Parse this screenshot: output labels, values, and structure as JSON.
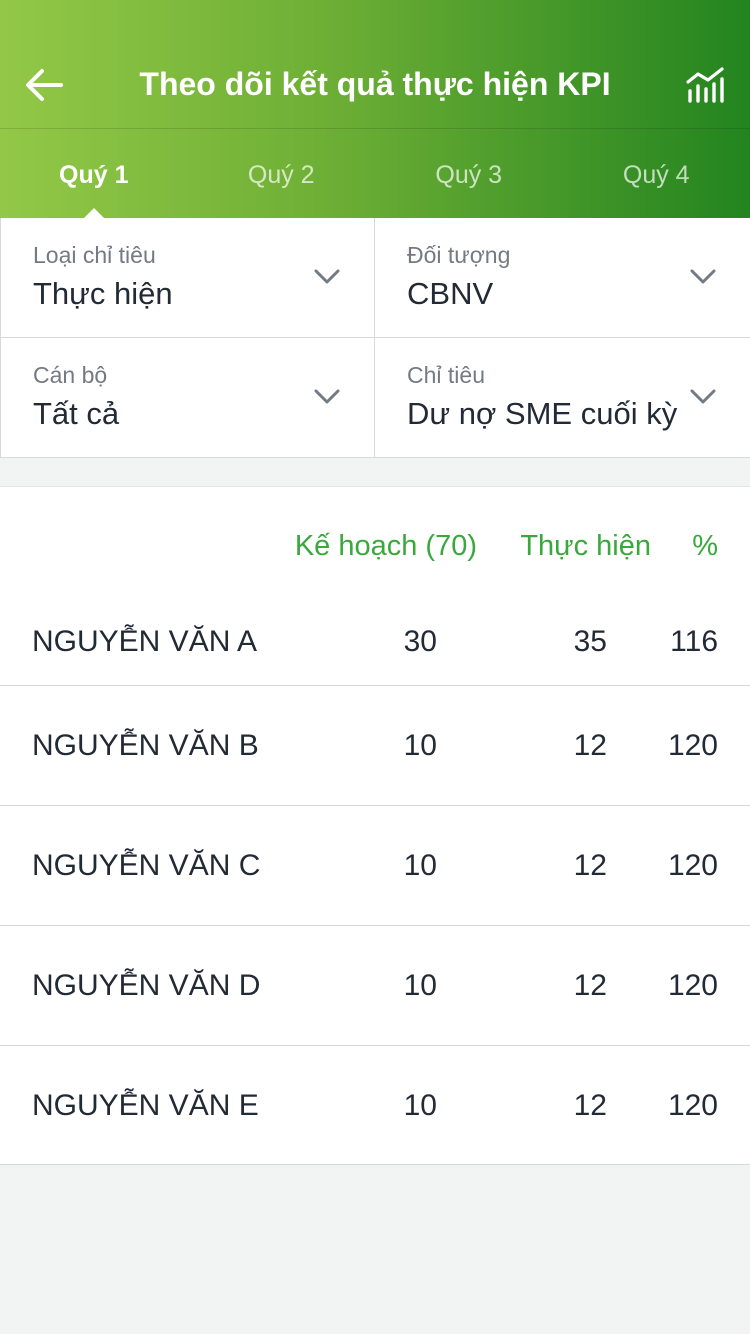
{
  "header": {
    "title": "Theo dõi kết quả thực hiện KPI",
    "back_icon": "arrow-left-icon",
    "chart_icon": "chart-icon"
  },
  "tabs": [
    {
      "label": "Quý 1",
      "active": true
    },
    {
      "label": "Quý 2",
      "active": false
    },
    {
      "label": "Quý 3",
      "active": false
    },
    {
      "label": "Quý 4",
      "active": false
    }
  ],
  "filters": {
    "indicator_type": {
      "label": "Loại chỉ tiêu",
      "value": "Thực hiện"
    },
    "subject": {
      "label": "Đối tượng",
      "value": "CBNV"
    },
    "staff": {
      "label": "Cán bộ",
      "value": "Tất cả"
    },
    "target": {
      "label": "Chỉ tiêu",
      "value": "Dư nợ SME cuối kỳ"
    }
  },
  "table": {
    "headers": {
      "plan": "Kế hoạch (70)",
      "actual": "Thực hiện",
      "percent": "%"
    },
    "rows": [
      {
        "name": "NGUYỄN VĂN A",
        "plan": "30",
        "actual": "35",
        "percent": "116"
      },
      {
        "name": "NGUYỄN VĂN B",
        "plan": "10",
        "actual": "12",
        "percent": "120"
      },
      {
        "name": "NGUYỄN VĂN C",
        "plan": "10",
        "actual": "12",
        "percent": "120"
      },
      {
        "name": "NGUYỄN VĂN D",
        "plan": "10",
        "actual": "12",
        "percent": "120"
      },
      {
        "name": "NGUYỄN VĂN E",
        "plan": "10",
        "actual": "12",
        "percent": "120"
      }
    ]
  },
  "colors": {
    "accent_green": "#3aa83d",
    "header_start": "#93c847",
    "header_end": "#23841f"
  }
}
